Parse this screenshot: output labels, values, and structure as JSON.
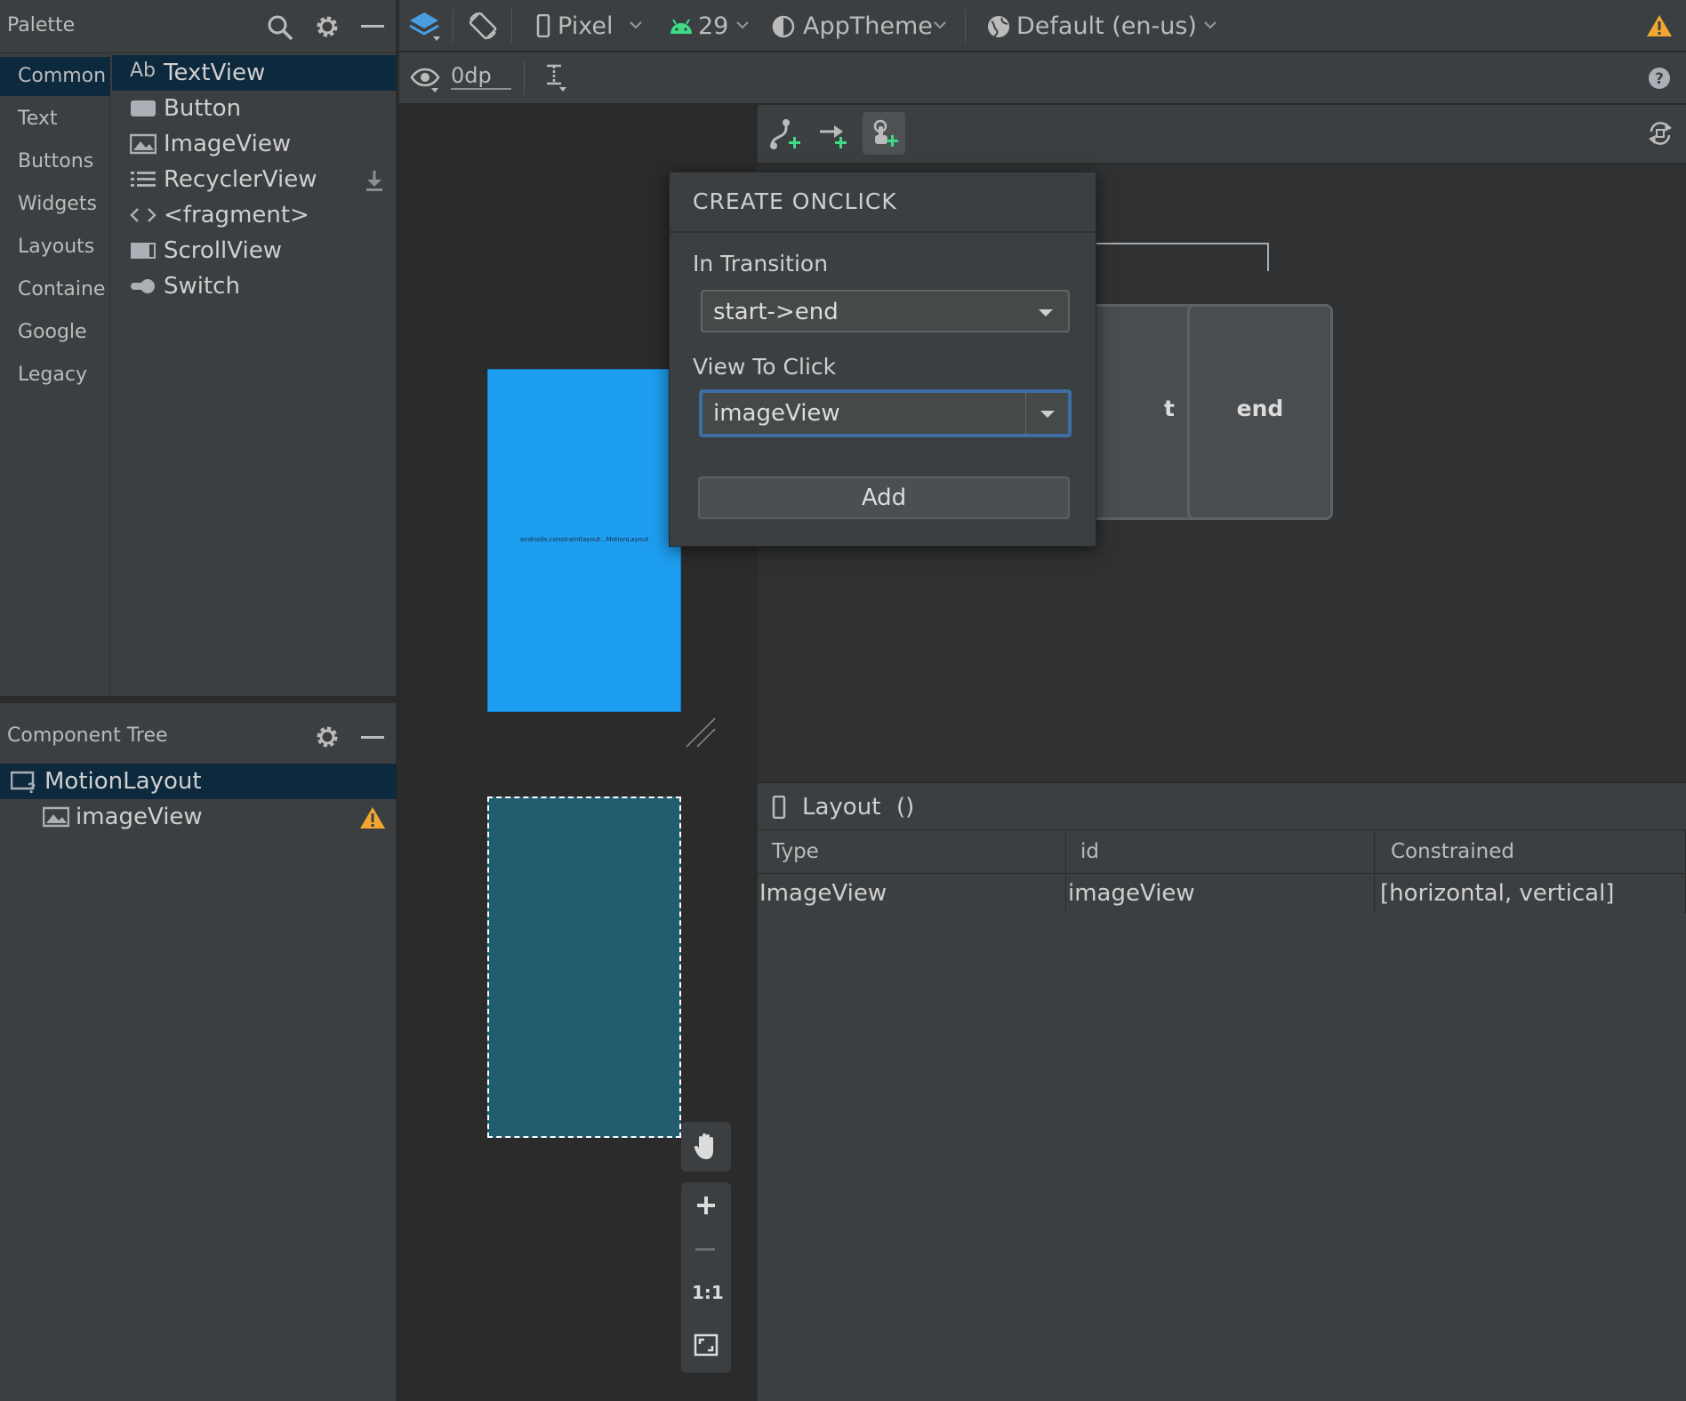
{
  "palette": {
    "title": "Palette",
    "categories": [
      "Common",
      "Text",
      "Buttons",
      "Widgets",
      "Layouts",
      "Containe",
      "Google",
      "Legacy"
    ],
    "components": [
      "TextView",
      "Button",
      "ImageView",
      "RecyclerView",
      "<fragment>",
      "ScrollView",
      "Switch"
    ],
    "textview_icon_text": "Ab"
  },
  "toolbar": {
    "device": "Pixel",
    "api": "29",
    "theme": "AppTheme",
    "locale": "Default (en-us)",
    "margin": "0dp"
  },
  "component_tree": {
    "title": "Component Tree",
    "items": [
      "MotionLayout",
      "imageView"
    ]
  },
  "canvas": {
    "preview_label": "androidx.constraintlayout...MotionLayout",
    "zoom_reset": "1:1"
  },
  "motion": {
    "start_state_partial": "t",
    "end_state": "end"
  },
  "popup": {
    "title": "CREATE ONCLICK",
    "transition_label": "In Transition",
    "transition_value": "start->end",
    "view_label": "View To Click",
    "view_value": "imageView",
    "add_button": "Add"
  },
  "layout_panel": {
    "title": "Layout",
    "title_suffix": "()",
    "columns": [
      "Type",
      "id",
      "Constrained"
    ],
    "rows": [
      [
        "ImageView",
        "imageView",
        "[horizontal, vertical]"
      ]
    ]
  },
  "colors": {
    "accent_blue": "#1e9ef1",
    "selection": "#0d293e",
    "warning": "#f0a732",
    "android_green": "#3ddc84"
  }
}
